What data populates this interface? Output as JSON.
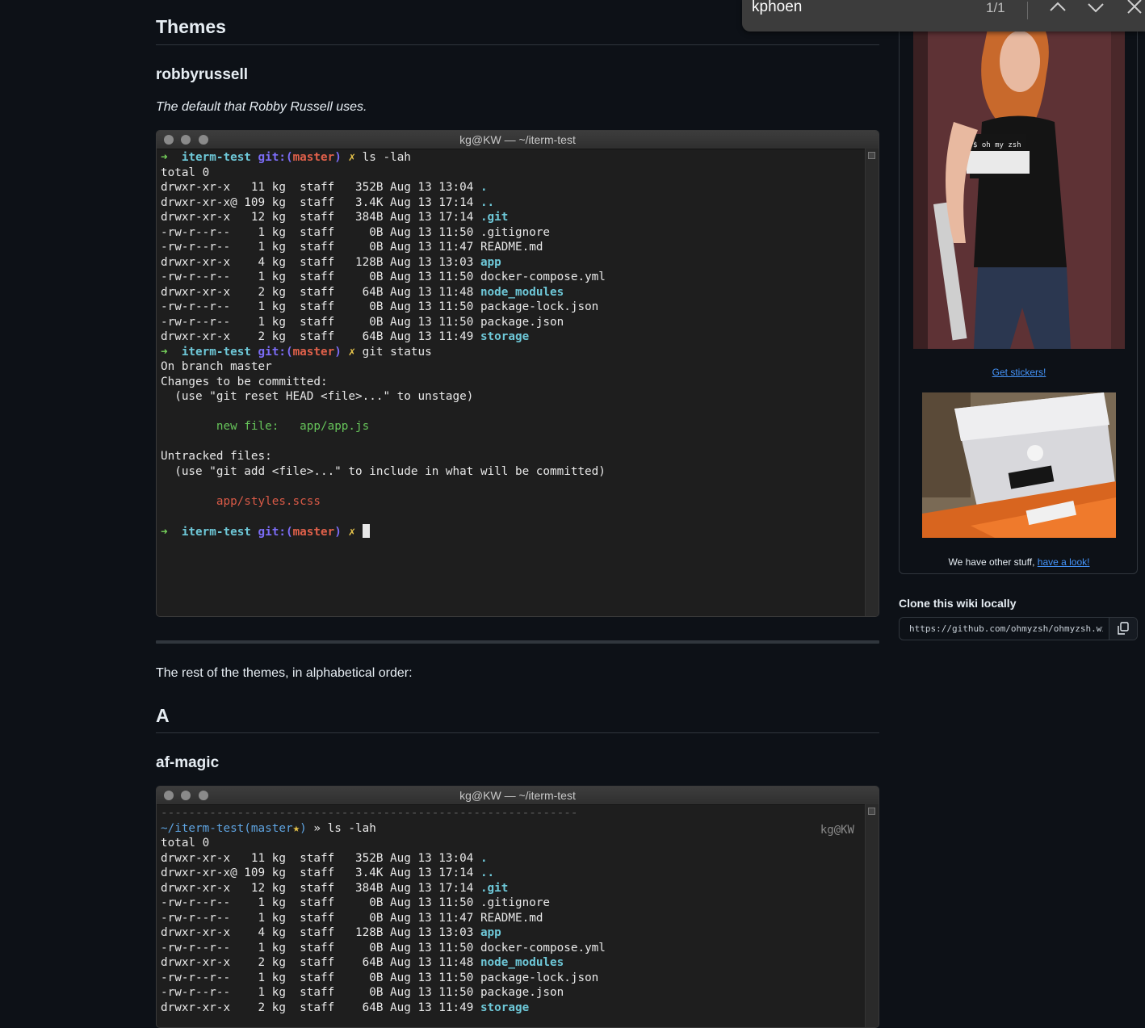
{
  "main": {
    "themes_heading": "Themes",
    "robbyrussell": {
      "heading": "robbyrussell",
      "description": "The default that Robby Russell uses."
    },
    "terminal_title": "kg@KW — ~/iterm-test",
    "rest_text": "The rest of the themes, in alphabetical order:",
    "letter_heading": "A",
    "afmagic": {
      "heading": "af-magic"
    }
  },
  "term1": {
    "prompt_dir": "iterm-test",
    "prompt_git": "git:(",
    "prompt_branch": "master",
    "prompt_close": ")",
    "prompt_x": "✗",
    "cmd1": "ls -lah",
    "cmd2": "git status",
    "total": "total 0",
    "ls_rows": [
      {
        "perm": "drwxr-xr-x ",
        "links": " 11",
        "size": " 352B",
        "date": "Aug 13 13:04",
        "name": ".",
        "dir": true
      },
      {
        "perm": "drwxr-xr-x@",
        "links": "109",
        "size": " 3.4K",
        "date": "Aug 13 17:14",
        "name": "..",
        "dir": true
      },
      {
        "perm": "drwxr-xr-x ",
        "links": " 12",
        "size": " 384B",
        "date": "Aug 13 17:14",
        "name": ".git",
        "dir": true
      },
      {
        "perm": "-rw-r--r-- ",
        "links": "  1",
        "size": "   0B",
        "date": "Aug 13 11:50",
        "name": ".gitignore",
        "dir": false
      },
      {
        "perm": "-rw-r--r-- ",
        "links": "  1",
        "size": "   0B",
        "date": "Aug 13 11:47",
        "name": "README.md",
        "dir": false
      },
      {
        "perm": "drwxr-xr-x ",
        "links": "  4",
        "size": " 128B",
        "date": "Aug 13 13:03",
        "name": "app",
        "dir": true
      },
      {
        "perm": "-rw-r--r-- ",
        "links": "  1",
        "size": "   0B",
        "date": "Aug 13 11:50",
        "name": "docker-compose.yml",
        "dir": false
      },
      {
        "perm": "drwxr-xr-x ",
        "links": "  2",
        "size": "  64B",
        "date": "Aug 13 11:48",
        "name": "node_modules",
        "dir": true
      },
      {
        "perm": "-rw-r--r-- ",
        "links": "  1",
        "size": "   0B",
        "date": "Aug 13 11:50",
        "name": "package-lock.json",
        "dir": false
      },
      {
        "perm": "-rw-r--r-- ",
        "links": "  1",
        "size": "   0B",
        "date": "Aug 13 11:50",
        "name": "package.json",
        "dir": false
      },
      {
        "perm": "drwxr-xr-x ",
        "links": "  2",
        "size": "  64B",
        "date": "Aug 13 11:49",
        "name": "storage",
        "dir": true
      }
    ],
    "owner": "kg",
    "group": "staff",
    "status": {
      "on_branch": "On branch master",
      "to_commit": "Changes to be committed:",
      "unstage_hint": "  (use \"git reset HEAD <file>...\" to unstage)",
      "new_file_label": "        new file:   ",
      "new_file_path": "app/app.js",
      "untracked": "Untracked files:",
      "include_hint": "  (use \"git add <file>...\" to include in what will be committed)",
      "untracked_file": "        app/styles.scss"
    }
  },
  "term2": {
    "dashes": "------------------------------------------------------------",
    "path": "~/iterm-test",
    "branch_open": "(",
    "branch": "master",
    "star": "★",
    "branch_close": ")",
    "raquo": " » ",
    "cmd": "ls -lah",
    "right_info": "kg@KW"
  },
  "sidebar": {
    "get_stickers": "Get stickers!",
    "other_stuff": "We have other stuff, ",
    "have_a_look": "have a look!",
    "clone_heading": "Clone this wiki locally",
    "clone_url": "https://github.com/ohmyzsh/ohmyzsh.wiki.git"
  },
  "findbar": {
    "query": "kphoen",
    "count": "1/1"
  },
  "colors": {
    "page_bg": "#0d1117",
    "link": "#4493f8",
    "term_bg": "#1e1e1e",
    "prompt_green": "#76d35b",
    "prompt_cyan": "#6ec8d8",
    "git_blue": "#7b6cf5",
    "branch_red": "#e0604a"
  }
}
